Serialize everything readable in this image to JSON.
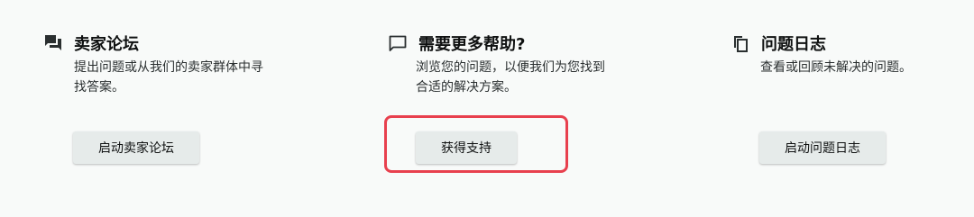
{
  "forum": {
    "icon": "forum-chat-icon",
    "title": "卖家论坛",
    "description": "提出问题或从我们的卖家群体中寻找答案。",
    "button_label": "启动卖家论坛"
  },
  "help": {
    "icon": "speech-bubble-icon",
    "title": "需要更多帮助?",
    "description": "浏览您的问题，以便我们为您找到合适的解决方案。",
    "button_label": "获得支持"
  },
  "issue_log": {
    "icon": "copy-pages-icon",
    "title": "问题日志",
    "description": "查看或回顾未解决的问题。",
    "button_label": "启动问题日志"
  },
  "colors": {
    "background": "#f8faf9",
    "button_background": "#e6ebea",
    "highlight_border": "#e8404e",
    "text": "#0f1111"
  }
}
